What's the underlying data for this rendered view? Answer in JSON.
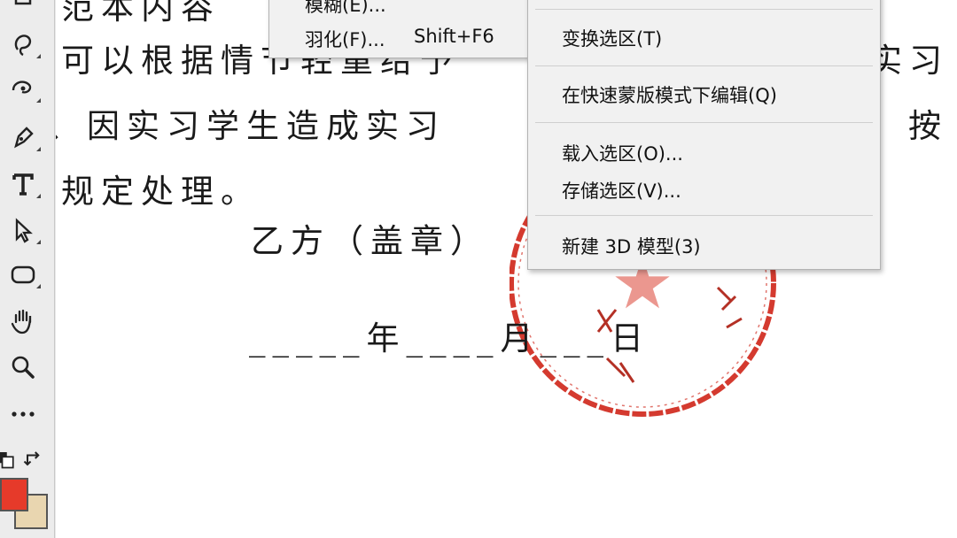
{
  "document": {
    "line1": "范本内容",
    "line2": "可以根据情节轻重给予",
    "line2_right": "实习",
    "line3": "、因实习学生造成实习",
    "line3_right": "按",
    "line4": "规定处理。",
    "party_b": "乙方（盖章）",
    "date_line": "_____年____月___日"
  },
  "seal": {
    "star": "★"
  },
  "left_menu": {
    "partial": "模糊(E)...",
    "feather": "羽化(F)...",
    "feather_shortcut": "Shift+F6"
  },
  "right_menu": {
    "transform": "变换选区(T)",
    "quick_mask": "在快速蒙版模式下编辑(Q)",
    "load": "载入选区(O)...",
    "save": "存储选区(V)...",
    "new3d": "新建 3D 模型(3)"
  },
  "tools": [
    "lasso-icon",
    "healing-brush-icon",
    "pen-icon",
    "type-tool-icon",
    "path-select-icon",
    "rectangle-icon",
    "hand-icon",
    "zoom-icon",
    "more-tools-icon"
  ],
  "colors": {
    "foreground": "#e63a2a",
    "background": "#e9d6b0",
    "seal_red": "#d43a2f"
  }
}
